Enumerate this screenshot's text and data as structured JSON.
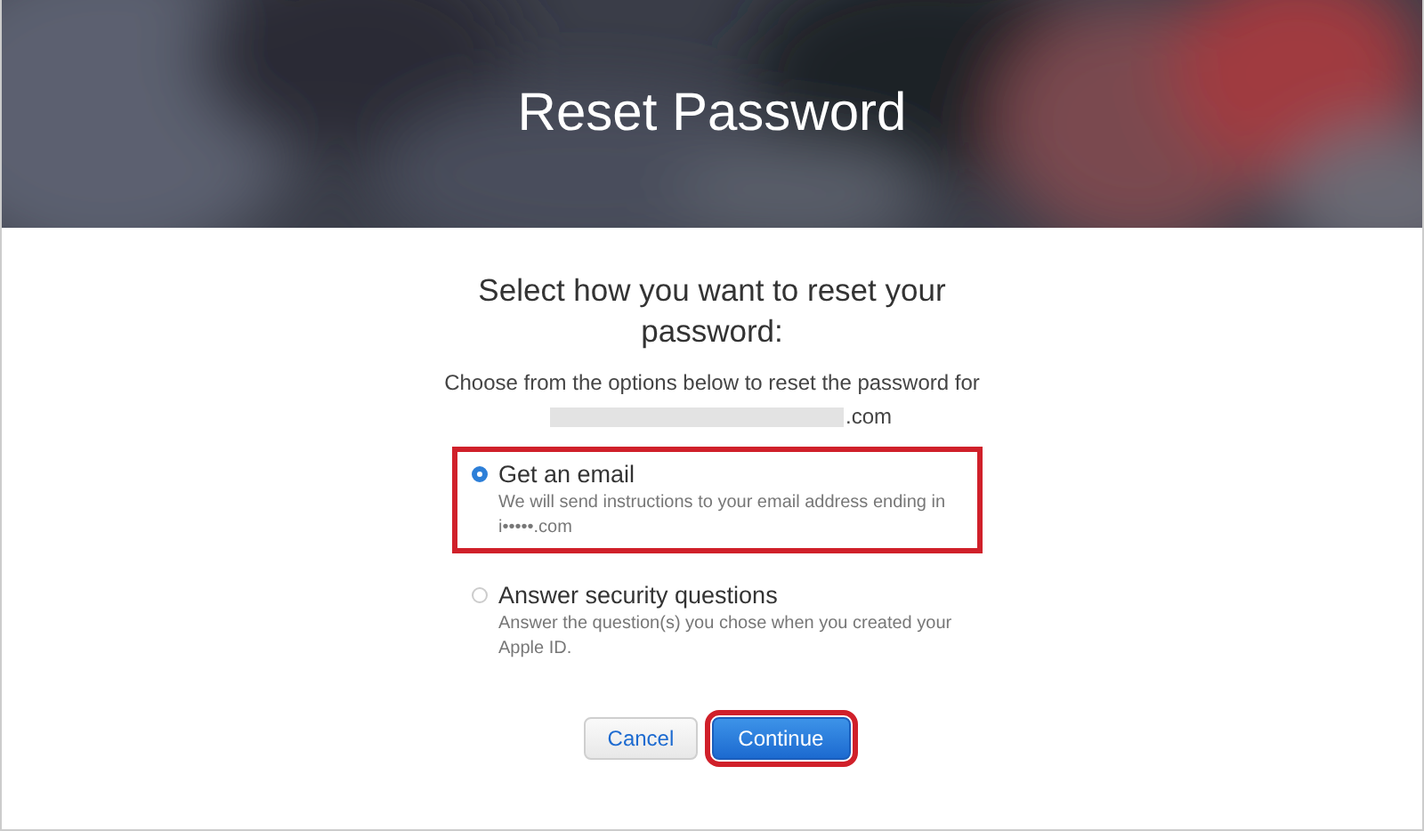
{
  "header": {
    "title": "Reset Password"
  },
  "heading": "Select how you want to reset your password:",
  "instructions": "Choose from the options below to reset the password for",
  "account_suffix": ".com",
  "options": [
    {
      "label": "Get an email",
      "description": "We will send instructions to your email address ending in i•••••.com",
      "selected": true,
      "highlighted": true
    },
    {
      "label": "Answer security questions",
      "description": "Answer the question(s) you chose when you created your Apple ID.",
      "selected": false,
      "highlighted": false
    }
  ],
  "buttons": [
    {
      "label": "Cancel",
      "kind": "secondary",
      "highlighted": false
    },
    {
      "label": "Continue",
      "kind": "primary",
      "highlighted": true
    }
  ]
}
